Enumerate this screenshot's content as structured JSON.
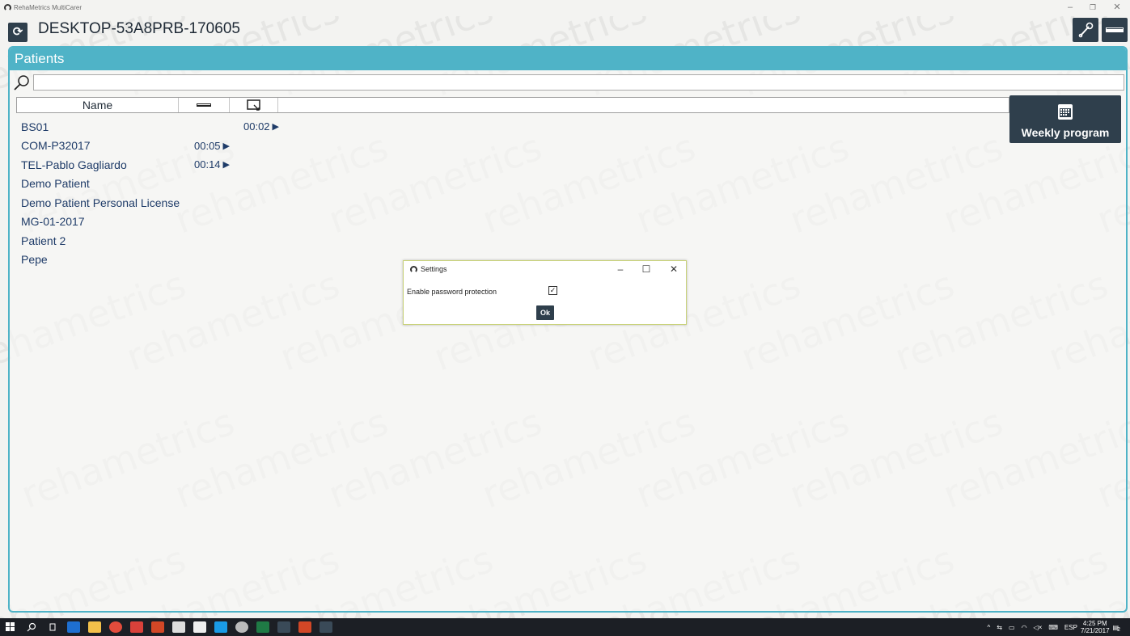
{
  "window": {
    "app_title": "RehaMetrics MultiCarer",
    "minimize": "–",
    "restore": "❐",
    "close": "✕"
  },
  "header": {
    "device_name": "DESKTOP-53A8PRB-170605",
    "refresh_symbol": "⟳"
  },
  "watermark_text": "rehametrics",
  "patients_panel": {
    "title": "Patients",
    "search": {
      "value": "",
      "placeholder": ""
    },
    "columns": [
      "Name",
      "",
      ""
    ],
    "rows": [
      {
        "name": "BS01",
        "time_col": 3,
        "time": "00:02"
      },
      {
        "name": "COM-P32017",
        "time_col": 2,
        "time": "00:05"
      },
      {
        "name": "TEL-Pablo Gagliardo",
        "time_col": 2,
        "time": "00:14"
      },
      {
        "name": "Demo Patient",
        "time_col": 0,
        "time": ""
      },
      {
        "name": "Demo Patient Personal License",
        "time_col": 0,
        "time": ""
      },
      {
        "name": "MG-01-2017",
        "time_col": 0,
        "time": ""
      },
      {
        "name": "Patient 2",
        "time_col": 0,
        "time": ""
      },
      {
        "name": "Pepe",
        "time_col": 0,
        "time": ""
      }
    ],
    "play_symbol": "▶",
    "weekly_program_label": "Weekly program"
  },
  "settings_dialog": {
    "title": "Settings",
    "minimize": "–",
    "maximize": "☐",
    "close": "✕",
    "option_label": "Enable password protection",
    "option_checked": true,
    "check_mark": "✓",
    "ok_label": "Ok"
  },
  "taskbar": {
    "icons": [
      "windows-start-icon",
      "search-icon",
      "task-view-icon",
      "edge-icon",
      "file-explorer-icon",
      "chrome-icon",
      "mail-icon",
      "powerpoint-file-icon",
      "store-icon",
      "mail-app-icon",
      "skype-icon",
      "app-icon",
      "excel-icon",
      "rehametrics-icon",
      "powerpoint-icon",
      "rehametrics-app-icon"
    ],
    "tray": {
      "language": "ESP",
      "time": "4:25 PM",
      "date": "7/21/2017",
      "notification_count": "2"
    }
  }
}
